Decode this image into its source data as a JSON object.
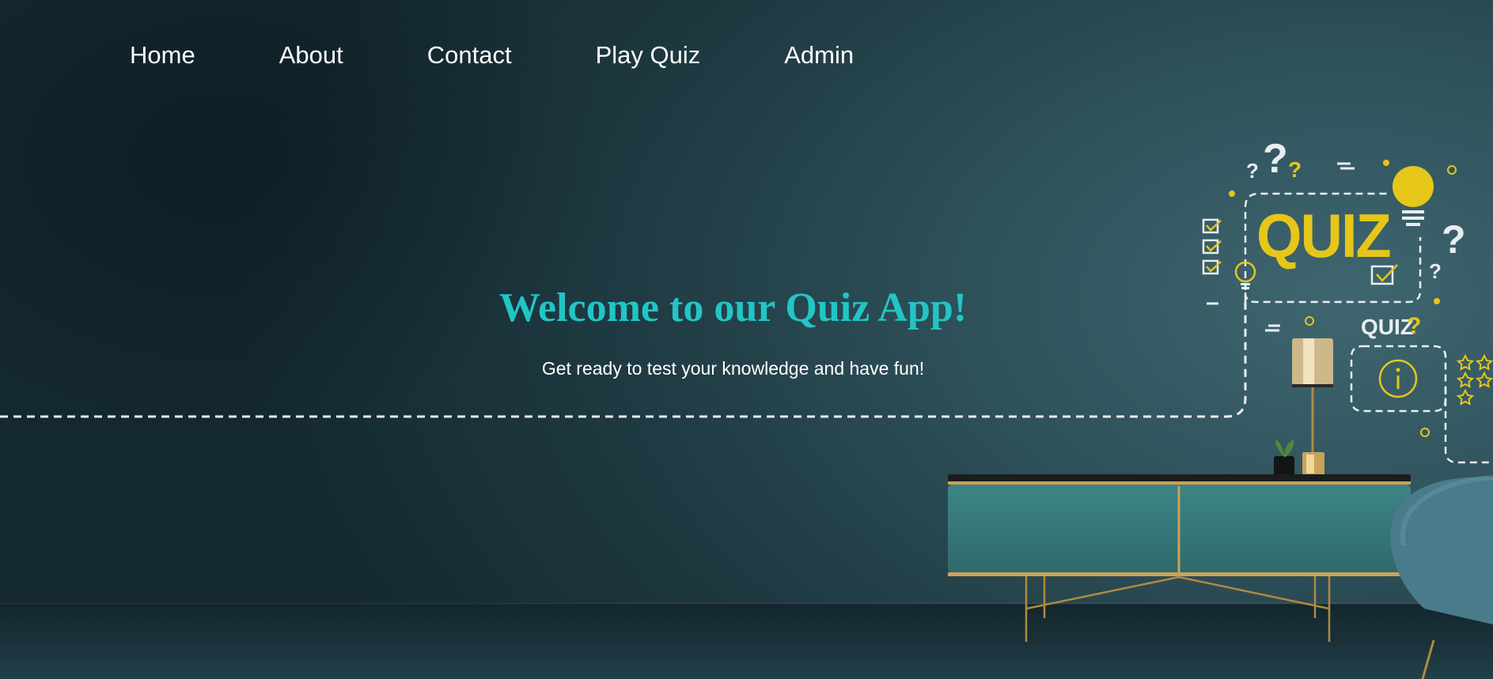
{
  "nav": {
    "items": [
      {
        "label": "Home"
      },
      {
        "label": "About"
      },
      {
        "label": "Contact"
      },
      {
        "label": "Play Quiz"
      },
      {
        "label": "Admin"
      }
    ]
  },
  "hero": {
    "title": "Welcome to our Quiz App!",
    "subtitle": "Get ready to test your knowledge and have fun!"
  },
  "illustration": {
    "main_word": "QUIZ",
    "small_word": "QUIZ",
    "accent_color": "#e6c619",
    "line_color": "#e8eef0",
    "icons": [
      "question-mark-icon",
      "lightbulb-icon",
      "checkbox-icon",
      "info-icon",
      "star-icon",
      "table-lamp",
      "plant-pot",
      "sideboard-cabinet",
      "armchair"
    ]
  },
  "colors": {
    "title": "#22c5c5",
    "nav_text": "#ffffff",
    "background": "#2e5059"
  }
}
